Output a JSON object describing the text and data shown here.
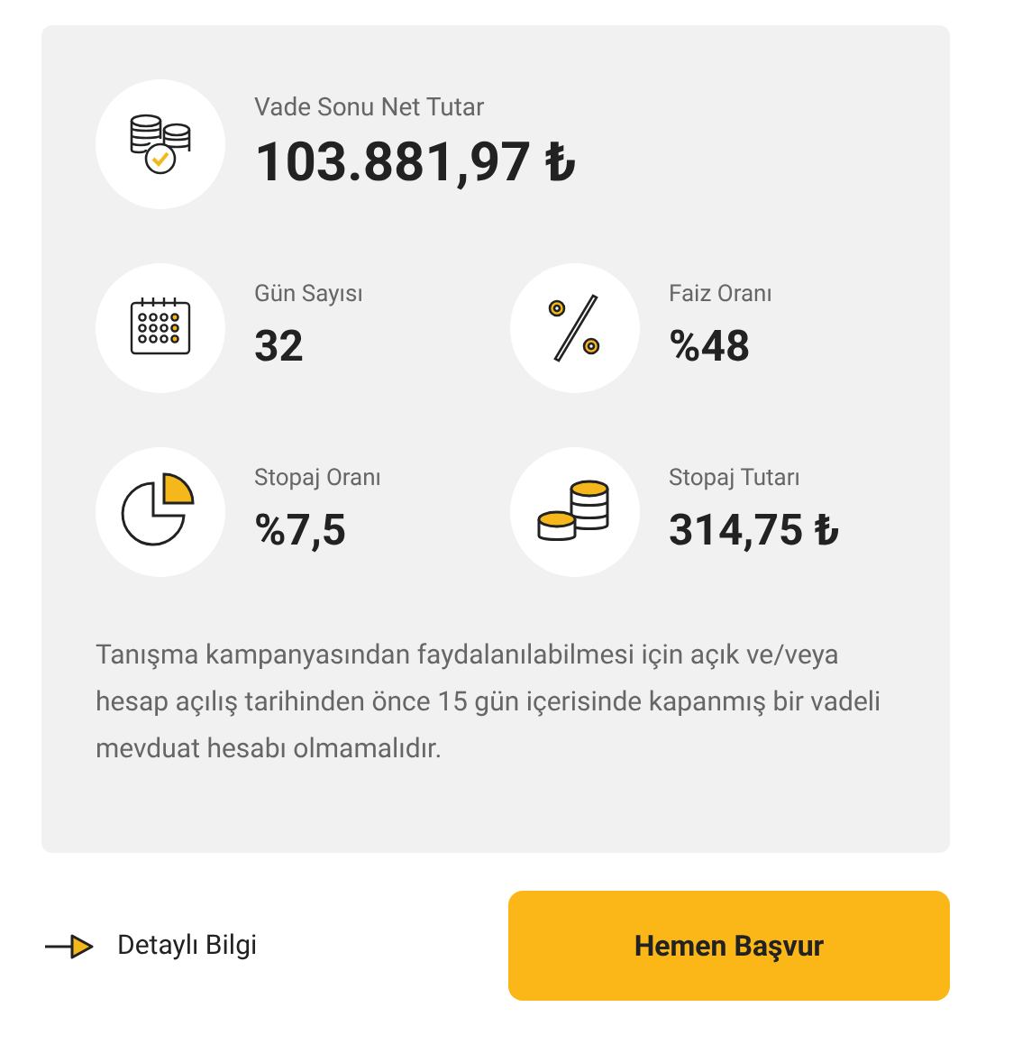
{
  "summary": {
    "label": "Vade Sonu Net Tutar",
    "value": "103.881,97 ₺"
  },
  "stats": [
    {
      "label": "Gün Sayısı",
      "value": "32"
    },
    {
      "label": "Faiz Oranı",
      "value": "%48"
    },
    {
      "label": "Stopaj Oranı",
      "value": "%7,5"
    },
    {
      "label": "Stopaj Tutarı",
      "value": "314,75 ₺"
    }
  ],
  "note": "Tanışma kampanyasından faydalanılabilmesi için açık ve/veya hesap açılış tarihinden önce 15 gün içerisinde kapanmış bir vadeli mevduat hesabı olmamalıdır.",
  "link": "Detaylı Bilgi",
  "button": "Hemen Başvur"
}
